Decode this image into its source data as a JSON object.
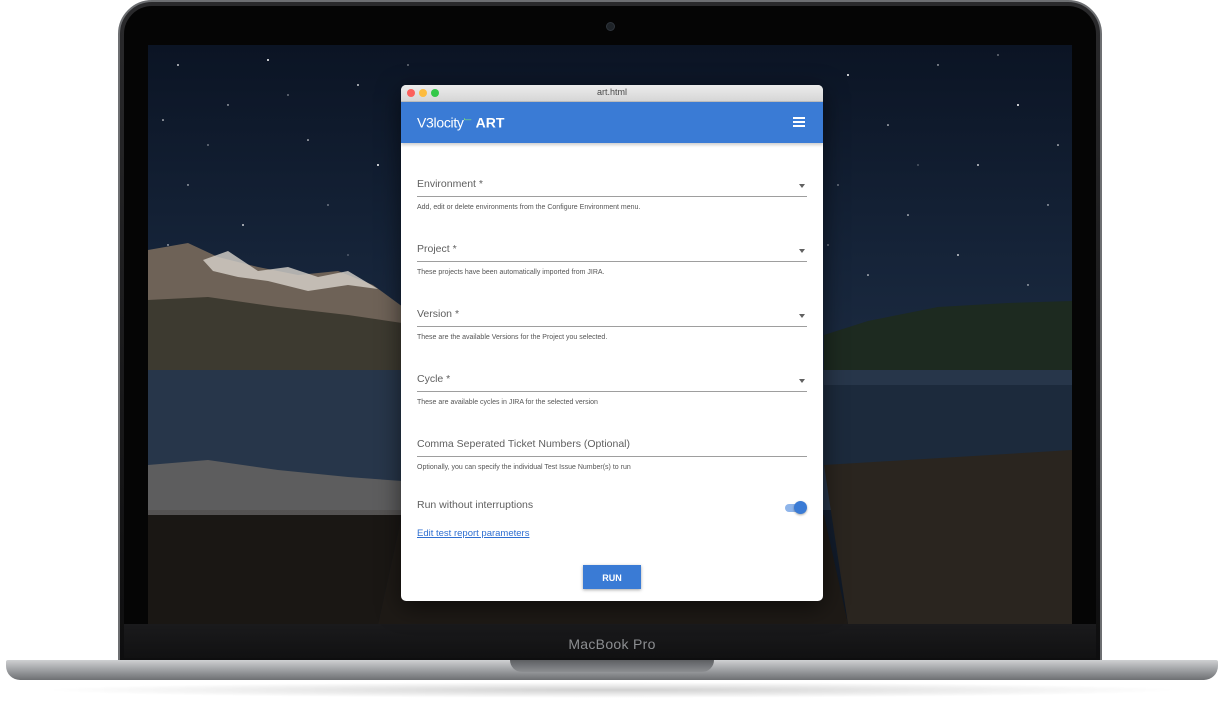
{
  "device": {
    "label": "MacBook Pro"
  },
  "window": {
    "title": "art.html"
  },
  "appbar": {
    "logo_text": "V3locity",
    "logo_mark": "⹃",
    "app_name": "ART",
    "menu_icon": "hamburger-menu-icon"
  },
  "form": {
    "fields": [
      {
        "label": "Environment *",
        "helper": "Add, edit or delete environments from the Configure Environment menu.",
        "type": "select"
      },
      {
        "label": "Project *",
        "helper": "These projects have been automatically imported from JIRA.",
        "type": "select"
      },
      {
        "label": "Version *",
        "helper": "These are the available Versions for the Project you selected.",
        "type": "select"
      },
      {
        "label": "Cycle *",
        "helper": "These are available cycles in JIRA for the selected version",
        "type": "select"
      },
      {
        "label": "Comma Seperated Ticket Numbers (Optional)",
        "helper": "Optionally, you can specify the individual Test Issue Number(s) to run",
        "type": "text"
      }
    ],
    "toggle": {
      "label": "Run without interruptions",
      "checked": true
    },
    "link": "Edit test report parameters",
    "run_label": "RUN"
  },
  "colors": {
    "primary": "#3a7bd5",
    "link": "#2f6fd1"
  }
}
